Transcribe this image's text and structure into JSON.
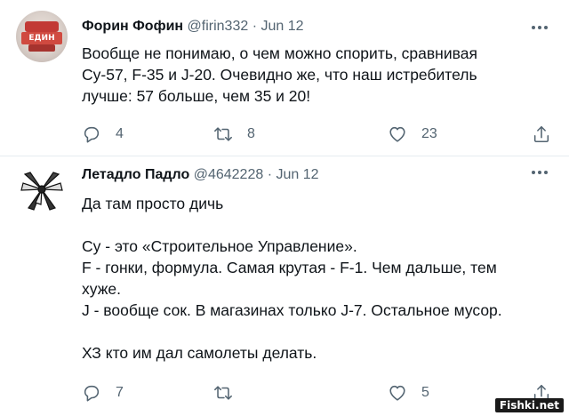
{
  "tweets": [
    {
      "name": "Форин Фофин",
      "handle": "@firin332",
      "separator": "·",
      "date": "Jun 12",
      "avatar_text": "ЕДИН",
      "lines": [
        "Вообще не понимаю, о чем можно спорить, сравнивая",
        "Су-57, F-35 и J-20. Очевидно же, что наш истребитель",
        "лучше: 57 больше, чем 35 и 20!"
      ],
      "reply_count": "4",
      "retweet_count": "8",
      "like_count": "23"
    },
    {
      "name": "Летадло Падло",
      "handle": "@4642228",
      "separator": "·",
      "date": "Jun 12",
      "lines": [
        "Да там просто дичь",
        "",
        "Су - это «Строительное Управление».",
        "F - гонки, формула. Самая крутая - F-1. Чем дальше, тем",
        "хуже.",
        "J - вообще сок. В магазинах только J-7. Остальное мусор.",
        "",
        "ХЗ кто им дал самолеты делать."
      ],
      "reply_count": "7",
      "retweet_count": "",
      "like_count": "5"
    }
  ],
  "icons": {
    "reply": "reply-icon",
    "retweet": "retweet-icon",
    "like": "heart-icon",
    "share": "share-icon",
    "more": "more-icon"
  },
  "colors": {
    "text": "#0f1419",
    "muted": "#536471",
    "separator": "#e6ecf0"
  },
  "watermark": "Fishki.net"
}
